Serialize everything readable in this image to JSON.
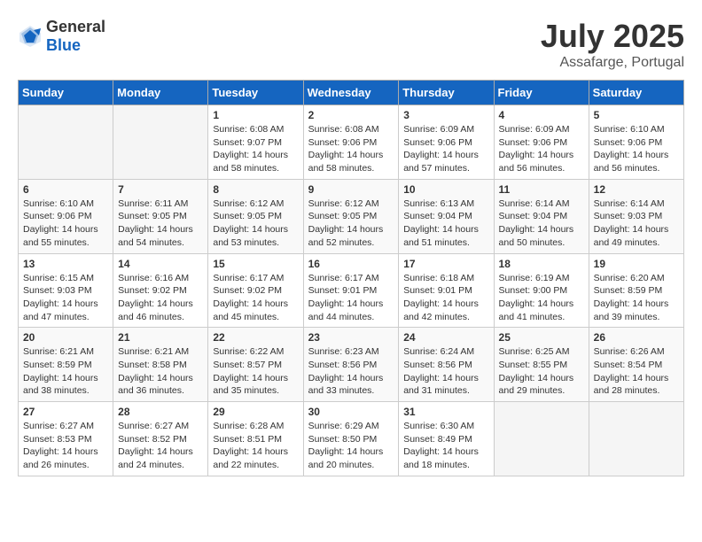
{
  "header": {
    "logo_general": "General",
    "logo_blue": "Blue",
    "month": "July 2025",
    "location": "Assafarge, Portugal"
  },
  "weekdays": [
    "Sunday",
    "Monday",
    "Tuesday",
    "Wednesday",
    "Thursday",
    "Friday",
    "Saturday"
  ],
  "weeks": [
    [
      {
        "day": "",
        "sunrise": "",
        "sunset": "",
        "daylight": ""
      },
      {
        "day": "",
        "sunrise": "",
        "sunset": "",
        "daylight": ""
      },
      {
        "day": "1",
        "sunrise": "Sunrise: 6:08 AM",
        "sunset": "Sunset: 9:07 PM",
        "daylight": "Daylight: 14 hours and 58 minutes."
      },
      {
        "day": "2",
        "sunrise": "Sunrise: 6:08 AM",
        "sunset": "Sunset: 9:06 PM",
        "daylight": "Daylight: 14 hours and 58 minutes."
      },
      {
        "day": "3",
        "sunrise": "Sunrise: 6:09 AM",
        "sunset": "Sunset: 9:06 PM",
        "daylight": "Daylight: 14 hours and 57 minutes."
      },
      {
        "day": "4",
        "sunrise": "Sunrise: 6:09 AM",
        "sunset": "Sunset: 9:06 PM",
        "daylight": "Daylight: 14 hours and 56 minutes."
      },
      {
        "day": "5",
        "sunrise": "Sunrise: 6:10 AM",
        "sunset": "Sunset: 9:06 PM",
        "daylight": "Daylight: 14 hours and 56 minutes."
      }
    ],
    [
      {
        "day": "6",
        "sunrise": "Sunrise: 6:10 AM",
        "sunset": "Sunset: 9:06 PM",
        "daylight": "Daylight: 14 hours and 55 minutes."
      },
      {
        "day": "7",
        "sunrise": "Sunrise: 6:11 AM",
        "sunset": "Sunset: 9:05 PM",
        "daylight": "Daylight: 14 hours and 54 minutes."
      },
      {
        "day": "8",
        "sunrise": "Sunrise: 6:12 AM",
        "sunset": "Sunset: 9:05 PM",
        "daylight": "Daylight: 14 hours and 53 minutes."
      },
      {
        "day": "9",
        "sunrise": "Sunrise: 6:12 AM",
        "sunset": "Sunset: 9:05 PM",
        "daylight": "Daylight: 14 hours and 52 minutes."
      },
      {
        "day": "10",
        "sunrise": "Sunrise: 6:13 AM",
        "sunset": "Sunset: 9:04 PM",
        "daylight": "Daylight: 14 hours and 51 minutes."
      },
      {
        "day": "11",
        "sunrise": "Sunrise: 6:14 AM",
        "sunset": "Sunset: 9:04 PM",
        "daylight": "Daylight: 14 hours and 50 minutes."
      },
      {
        "day": "12",
        "sunrise": "Sunrise: 6:14 AM",
        "sunset": "Sunset: 9:03 PM",
        "daylight": "Daylight: 14 hours and 49 minutes."
      }
    ],
    [
      {
        "day": "13",
        "sunrise": "Sunrise: 6:15 AM",
        "sunset": "Sunset: 9:03 PM",
        "daylight": "Daylight: 14 hours and 47 minutes."
      },
      {
        "day": "14",
        "sunrise": "Sunrise: 6:16 AM",
        "sunset": "Sunset: 9:02 PM",
        "daylight": "Daylight: 14 hours and 46 minutes."
      },
      {
        "day": "15",
        "sunrise": "Sunrise: 6:17 AM",
        "sunset": "Sunset: 9:02 PM",
        "daylight": "Daylight: 14 hours and 45 minutes."
      },
      {
        "day": "16",
        "sunrise": "Sunrise: 6:17 AM",
        "sunset": "Sunset: 9:01 PM",
        "daylight": "Daylight: 14 hours and 44 minutes."
      },
      {
        "day": "17",
        "sunrise": "Sunrise: 6:18 AM",
        "sunset": "Sunset: 9:01 PM",
        "daylight": "Daylight: 14 hours and 42 minutes."
      },
      {
        "day": "18",
        "sunrise": "Sunrise: 6:19 AM",
        "sunset": "Sunset: 9:00 PM",
        "daylight": "Daylight: 14 hours and 41 minutes."
      },
      {
        "day": "19",
        "sunrise": "Sunrise: 6:20 AM",
        "sunset": "Sunset: 8:59 PM",
        "daylight": "Daylight: 14 hours and 39 minutes."
      }
    ],
    [
      {
        "day": "20",
        "sunrise": "Sunrise: 6:21 AM",
        "sunset": "Sunset: 8:59 PM",
        "daylight": "Daylight: 14 hours and 38 minutes."
      },
      {
        "day": "21",
        "sunrise": "Sunrise: 6:21 AM",
        "sunset": "Sunset: 8:58 PM",
        "daylight": "Daylight: 14 hours and 36 minutes."
      },
      {
        "day": "22",
        "sunrise": "Sunrise: 6:22 AM",
        "sunset": "Sunset: 8:57 PM",
        "daylight": "Daylight: 14 hours and 35 minutes."
      },
      {
        "day": "23",
        "sunrise": "Sunrise: 6:23 AM",
        "sunset": "Sunset: 8:56 PM",
        "daylight": "Daylight: 14 hours and 33 minutes."
      },
      {
        "day": "24",
        "sunrise": "Sunrise: 6:24 AM",
        "sunset": "Sunset: 8:56 PM",
        "daylight": "Daylight: 14 hours and 31 minutes."
      },
      {
        "day": "25",
        "sunrise": "Sunrise: 6:25 AM",
        "sunset": "Sunset: 8:55 PM",
        "daylight": "Daylight: 14 hours and 29 minutes."
      },
      {
        "day": "26",
        "sunrise": "Sunrise: 6:26 AM",
        "sunset": "Sunset: 8:54 PM",
        "daylight": "Daylight: 14 hours and 28 minutes."
      }
    ],
    [
      {
        "day": "27",
        "sunrise": "Sunrise: 6:27 AM",
        "sunset": "Sunset: 8:53 PM",
        "daylight": "Daylight: 14 hours and 26 minutes."
      },
      {
        "day": "28",
        "sunrise": "Sunrise: 6:27 AM",
        "sunset": "Sunset: 8:52 PM",
        "daylight": "Daylight: 14 hours and 24 minutes."
      },
      {
        "day": "29",
        "sunrise": "Sunrise: 6:28 AM",
        "sunset": "Sunset: 8:51 PM",
        "daylight": "Daylight: 14 hours and 22 minutes."
      },
      {
        "day": "30",
        "sunrise": "Sunrise: 6:29 AM",
        "sunset": "Sunset: 8:50 PM",
        "daylight": "Daylight: 14 hours and 20 minutes."
      },
      {
        "day": "31",
        "sunrise": "Sunrise: 6:30 AM",
        "sunset": "Sunset: 8:49 PM",
        "daylight": "Daylight: 14 hours and 18 minutes."
      },
      {
        "day": "",
        "sunrise": "",
        "sunset": "",
        "daylight": ""
      },
      {
        "day": "",
        "sunrise": "",
        "sunset": "",
        "daylight": ""
      }
    ]
  ]
}
